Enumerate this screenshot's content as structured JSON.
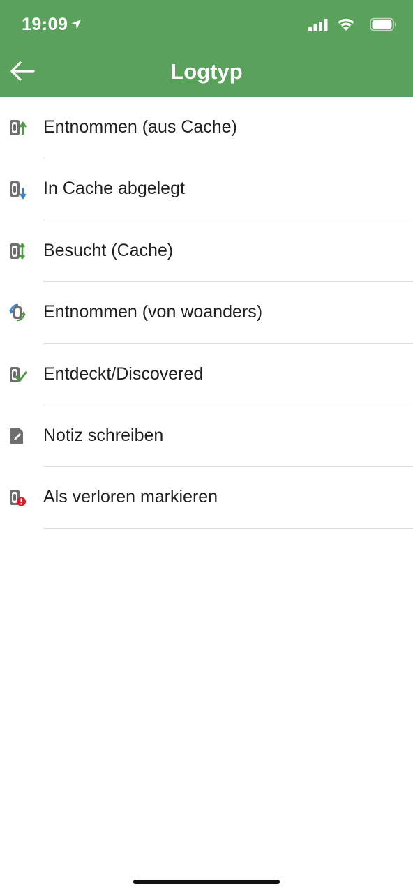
{
  "status_bar": {
    "time": "19:09"
  },
  "header": {
    "title": "Logtyp"
  },
  "list": {
    "items": [
      {
        "label": "Entnommen (aus Cache)",
        "icon": "trackable-retrieved-icon"
      },
      {
        "label": "In Cache abgelegt",
        "icon": "trackable-dropped-icon"
      },
      {
        "label": "Besucht (Cache)",
        "icon": "trackable-visited-icon"
      },
      {
        "label": "Entnommen (von woanders)",
        "icon": "trackable-grabbed-icon"
      },
      {
        "label": "Entdeckt/Discovered",
        "icon": "trackable-discovered-icon"
      },
      {
        "label": "Notiz schreiben",
        "icon": "write-note-icon"
      },
      {
        "label": "Als verloren markieren",
        "icon": "mark-missing-icon"
      }
    ]
  },
  "colors": {
    "header_green": "#5aa25c",
    "arrow_green": "#4a9d3f",
    "arrow_blue": "#3a7fc4",
    "alert_red": "#d0202a",
    "icon_gray": "#6e6e6e"
  }
}
